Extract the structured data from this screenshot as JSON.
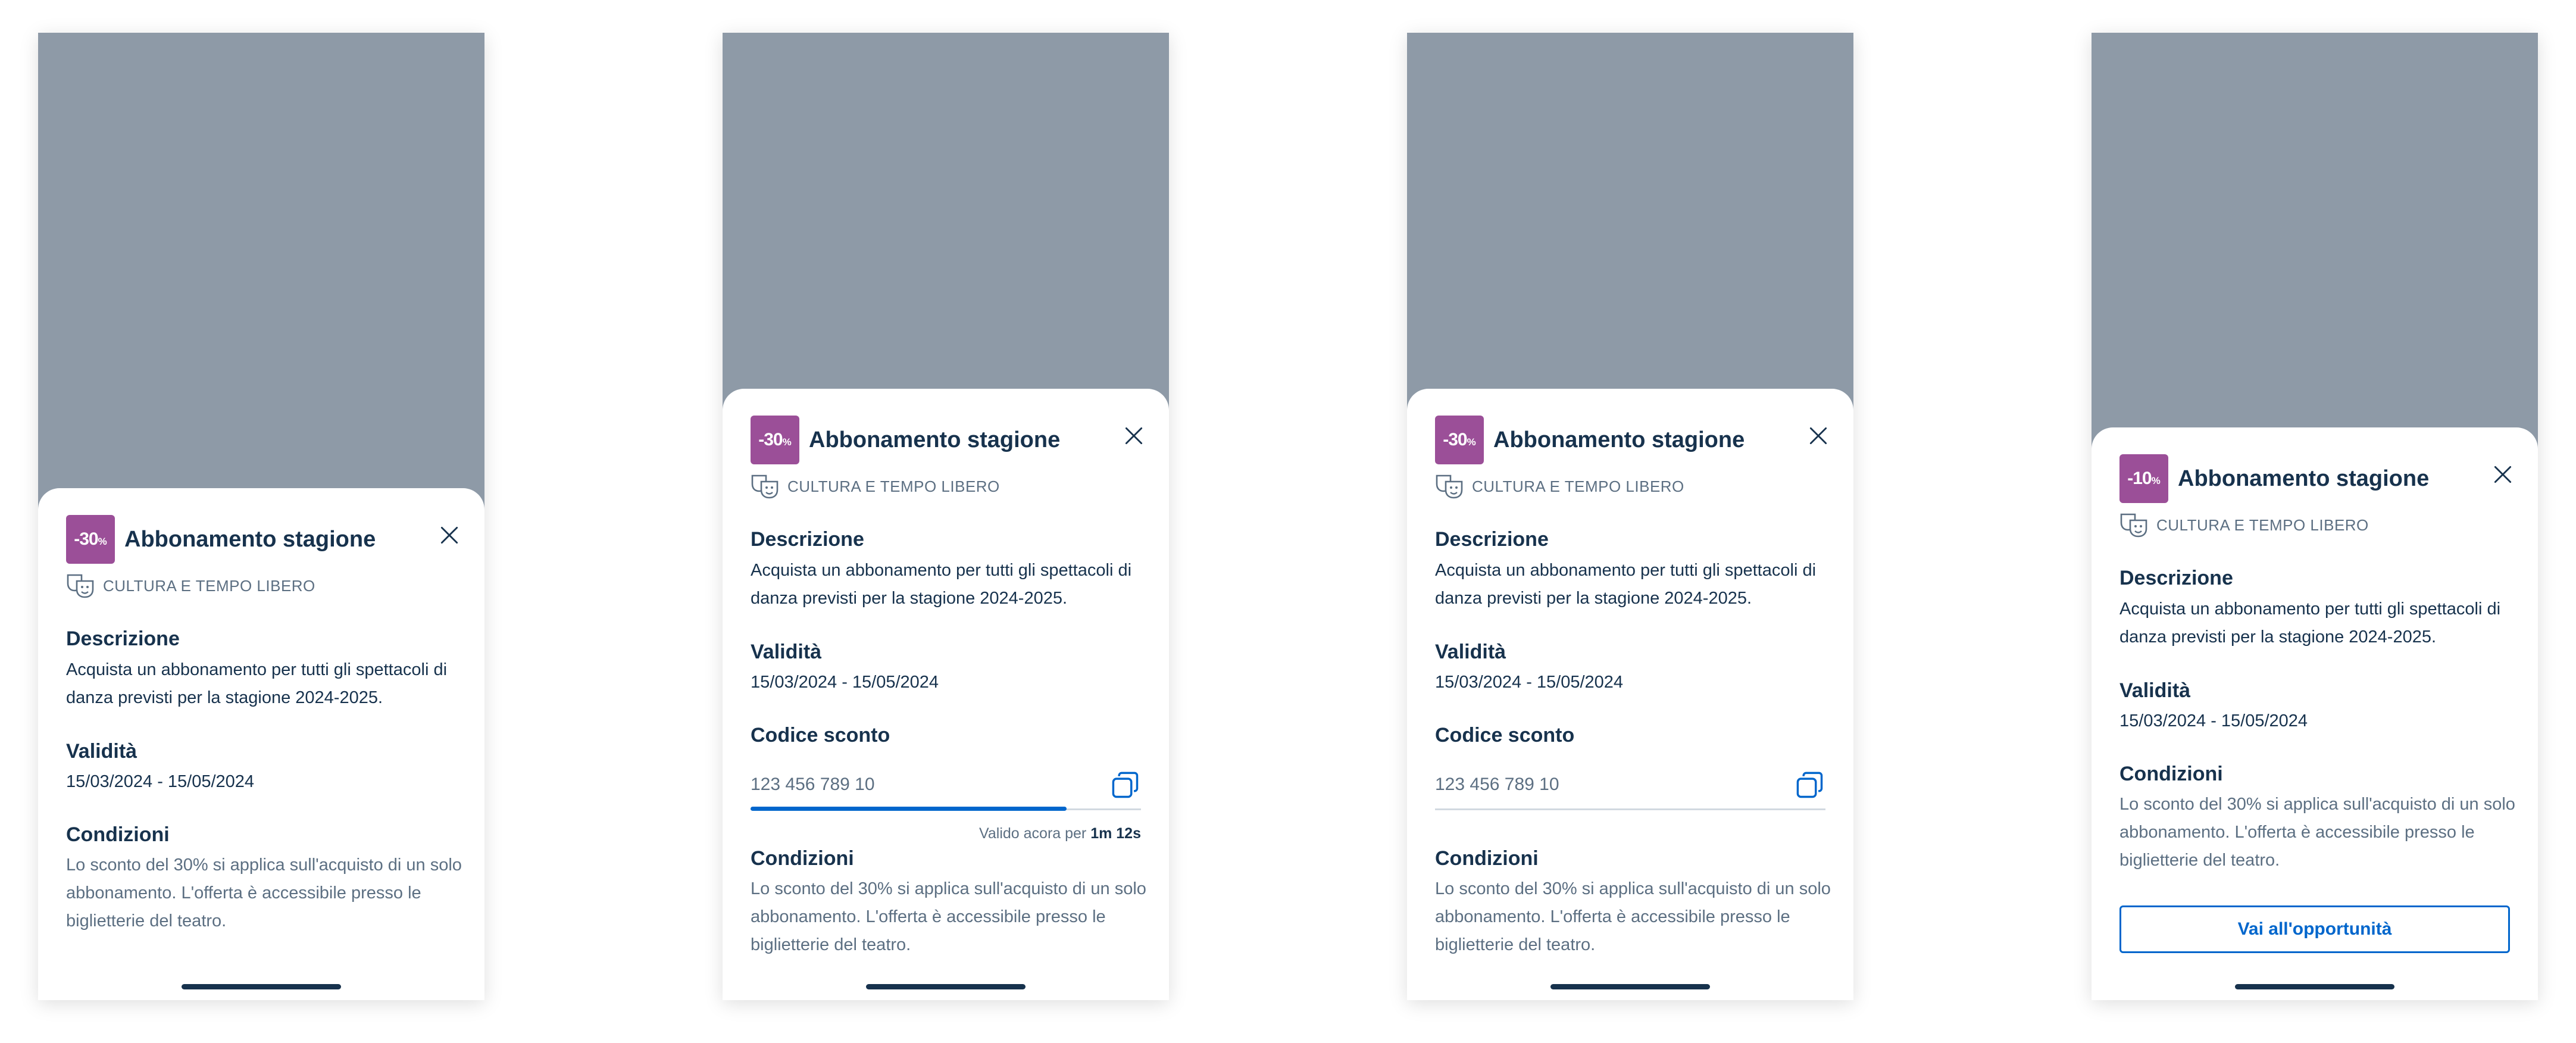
{
  "screens": [
    {
      "badge": {
        "value": "-30",
        "unit": "%",
        "color": "#9b4f98"
      },
      "title": "Abbonamento stagione",
      "category": {
        "icon": "theater-masks-icon",
        "label": "CULTURA E TEMPO LIBERO"
      },
      "description": {
        "title": "Descrizione",
        "text": "Acquista un abbonamento per tutti gli spettacoli di danza previsti per la stagione 2024-2025."
      },
      "validity": {
        "title": "Validità",
        "text": "15/03/2024 - 15/05/2024"
      },
      "conditions": {
        "title": "Condizioni",
        "text": "Lo sconto del 30% si applica sull'acquisto di un solo abbonamento. L'offerta è accessibile presso le biglietterie del teatro."
      }
    },
    {
      "badge": {
        "value": "-30",
        "unit": "%",
        "color": "#9b4f98"
      },
      "title": "Abbonamento stagione",
      "category": {
        "icon": "theater-masks-icon",
        "label": "CULTURA E TEMPO LIBERO"
      },
      "description": {
        "title": "Descrizione",
        "text": "Acquista un abbonamento per tutti gli spettacoli di danza previsti per la stagione 2024-2025."
      },
      "validity": {
        "title": "Validità",
        "text": "15/03/2024 - 15/05/2024"
      },
      "discount_code": {
        "title": "Codice sconto",
        "value": "123 456 789 10",
        "progress": 0.81
      },
      "timer": {
        "prefix": "Valido acora per",
        "time": "1m 12s"
      },
      "conditions": {
        "title": "Condizioni",
        "text": "Lo sconto del 30% si applica sull'acquisto di un solo abbonamento. L'offerta è accessibile presso le biglietterie del teatro."
      }
    },
    {
      "badge": {
        "value": "-30",
        "unit": "%",
        "color": "#9b4f98"
      },
      "title": "Abbonamento stagione",
      "category": {
        "icon": "theater-masks-icon",
        "label": "CULTURA E TEMPO LIBERO"
      },
      "description": {
        "title": "Descrizione",
        "text": "Acquista un abbonamento per tutti gli spettacoli di danza previsti per la stagione 2024-2025."
      },
      "validity": {
        "title": "Validità",
        "text": "15/03/2024 - 15/05/2024"
      },
      "discount_code": {
        "title": "Codice sconto",
        "value": "123 456 789 10"
      },
      "conditions": {
        "title": "Condizioni",
        "text": "Lo sconto del 30% si applica sull'acquisto di un solo abbonamento. L'offerta è accessibile presso le biglietterie del teatro."
      }
    },
    {
      "badge": {
        "value": "-10",
        "unit": "%",
        "color": "#9b4f98"
      },
      "title": "Abbonamento stagione",
      "category": {
        "icon": "theater-masks-icon",
        "label": "CULTURA E TEMPO LIBERO"
      },
      "description": {
        "title": "Descrizione",
        "text": "Acquista un abbonamento per tutti gli spettacoli di danza previsti per la stagione 2024-2025."
      },
      "validity": {
        "title": "Validità",
        "text": "15/03/2024 - 15/05/2024"
      },
      "conditions": {
        "title": "Condizioni",
        "text": "Lo sconto del 30% si applica sull'acquisto di un solo abbonamento. L'offerta è accessibile presso le biglietterie del teatro."
      },
      "cta_label": "Vai all'opportunità"
    }
  ],
  "colors": {
    "overlay": "#8e9aa7",
    "text": "#17324d",
    "muted": "#5c6f82",
    "primary": "#0066cc"
  }
}
